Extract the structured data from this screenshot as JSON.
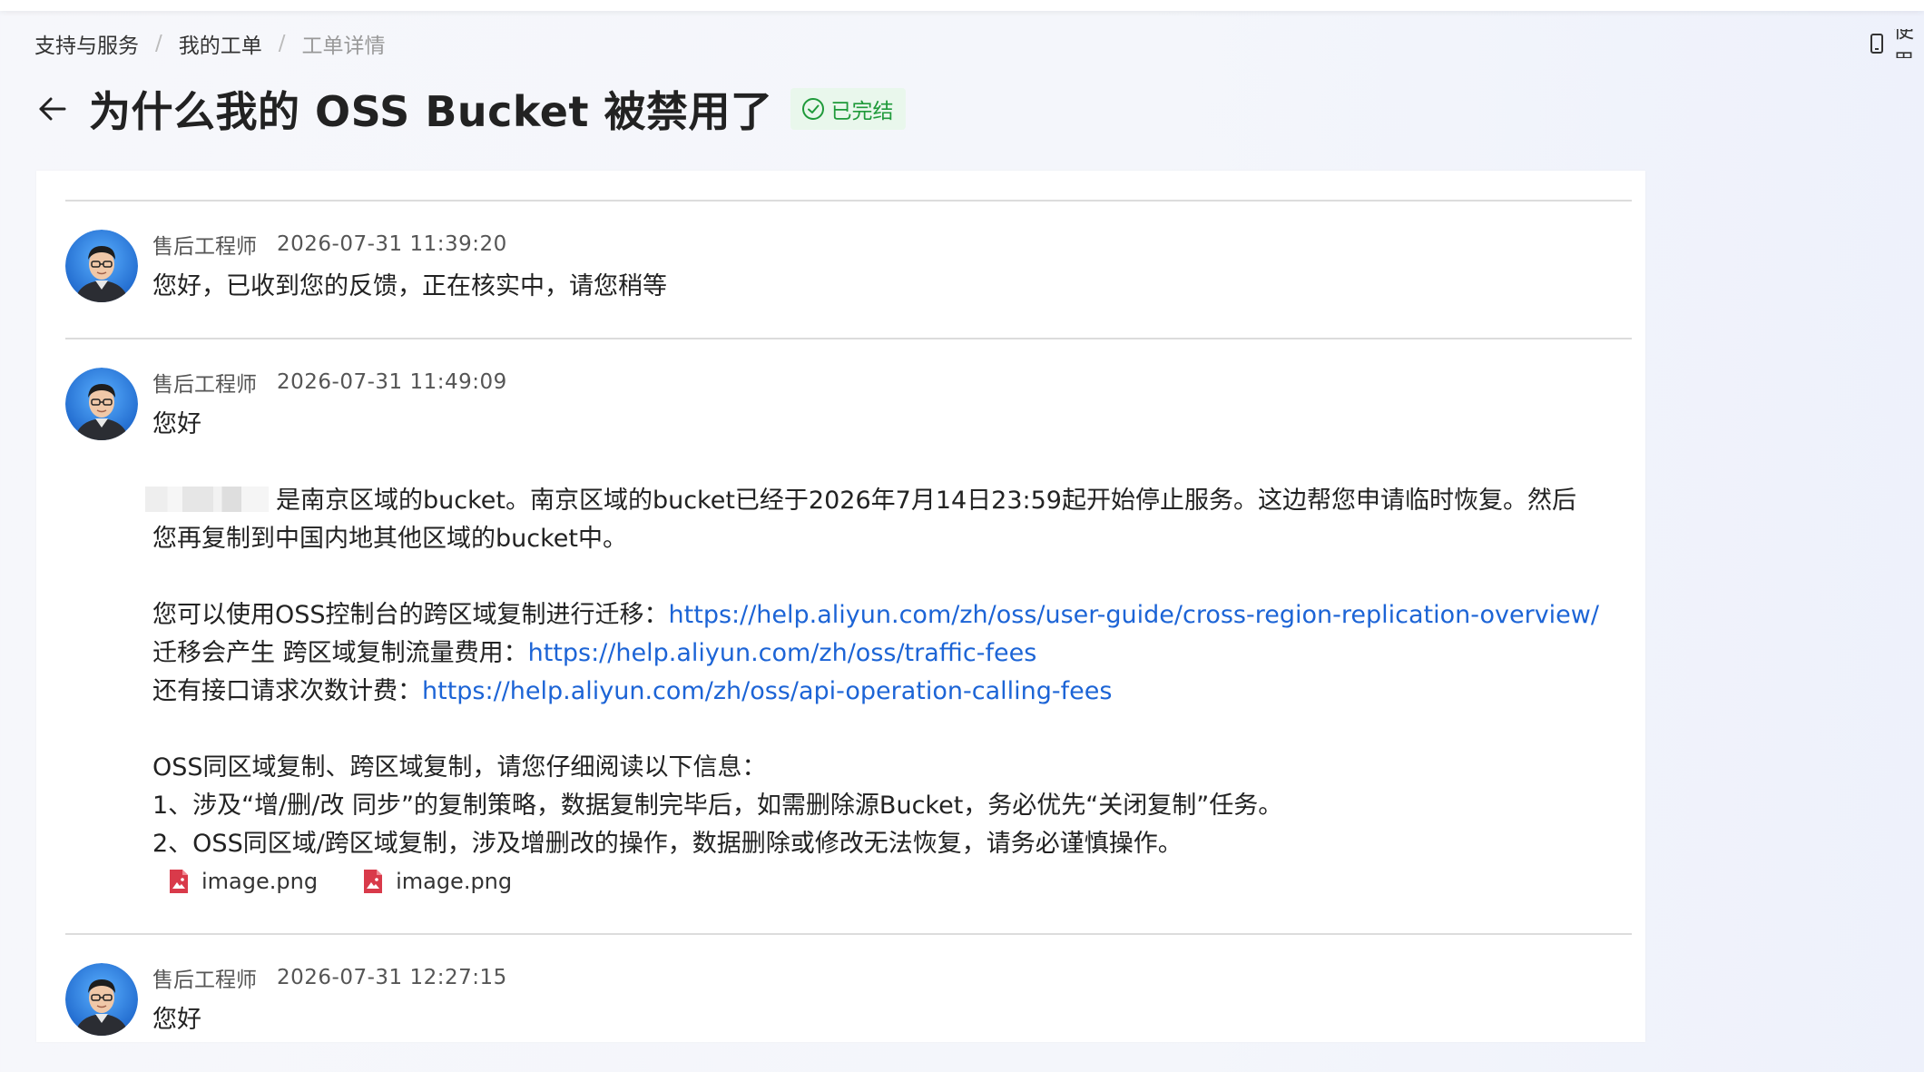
{
  "breadcrumb": {
    "items": [
      "支持与服务",
      "我的工单",
      "工单详情"
    ],
    "separator": "/"
  },
  "right_util": {
    "label": "使用"
  },
  "ticket": {
    "title": "为什么我的 OSS Bucket 被禁用了",
    "status": "已完结"
  },
  "messages": [
    {
      "author": "售后工程师",
      "time": "2026-07-31 11:39:20",
      "body": "您好，已收到您的反馈，正在核实中，请您稍等"
    },
    {
      "author": "售后工程师",
      "time": "2026-07-31 11:49:09",
      "greeting": "您好",
      "para1_line1_text": "是南京区域的bucket。南京区域的bucket已经于2026年7月14日23:59起开始停止服务。这边帮您申请临时恢复。然后",
      "para1_line2": "您再复制到中国内地其他区域的bucket中。",
      "link_lines": [
        {
          "prefix": "您可以使用OSS控制台的跨区域复制进行迁移：",
          "url": "https://help.aliyun.com/zh/oss/user-guide/cross-region-replication-overview/"
        },
        {
          "prefix": "迁移会产生 跨区域复制流量费用：",
          "url": "https://help.aliyun.com/zh/oss/traffic-fees"
        },
        {
          "prefix": "还有接口请求次数计费：",
          "url": "https://help.aliyun.com/zh/oss/api-operation-calling-fees"
        }
      ],
      "notice_title": "OSS同区域复制、跨区域复制，请您仔细阅读以下信息：",
      "notice_items": [
        "1、涉及“增/删/改 同步”的复制策略，数据复制完毕后，如需删除源Bucket，务必优先“关闭复制”任务。",
        "2、OSS同区域/跨区域复制，涉及增删改的操作，数据删除或修改无法恢复，请务必谨慎操作。"
      ],
      "attachments": [
        "image.png",
        "image.png"
      ]
    },
    {
      "author": "售后工程师",
      "time": "2026-07-31 12:27:15",
      "body": "您好"
    }
  ],
  "colors": {
    "link": "#1c64d6",
    "status_bg": "#e9f7ec",
    "status_text": "#1f9a3a",
    "attachment_icon": "#d93a4a"
  },
  "icons": {
    "back": "arrow-left-icon",
    "status": "check-circle-icon",
    "attachment": "image-file-icon",
    "device": "phone-icon"
  }
}
